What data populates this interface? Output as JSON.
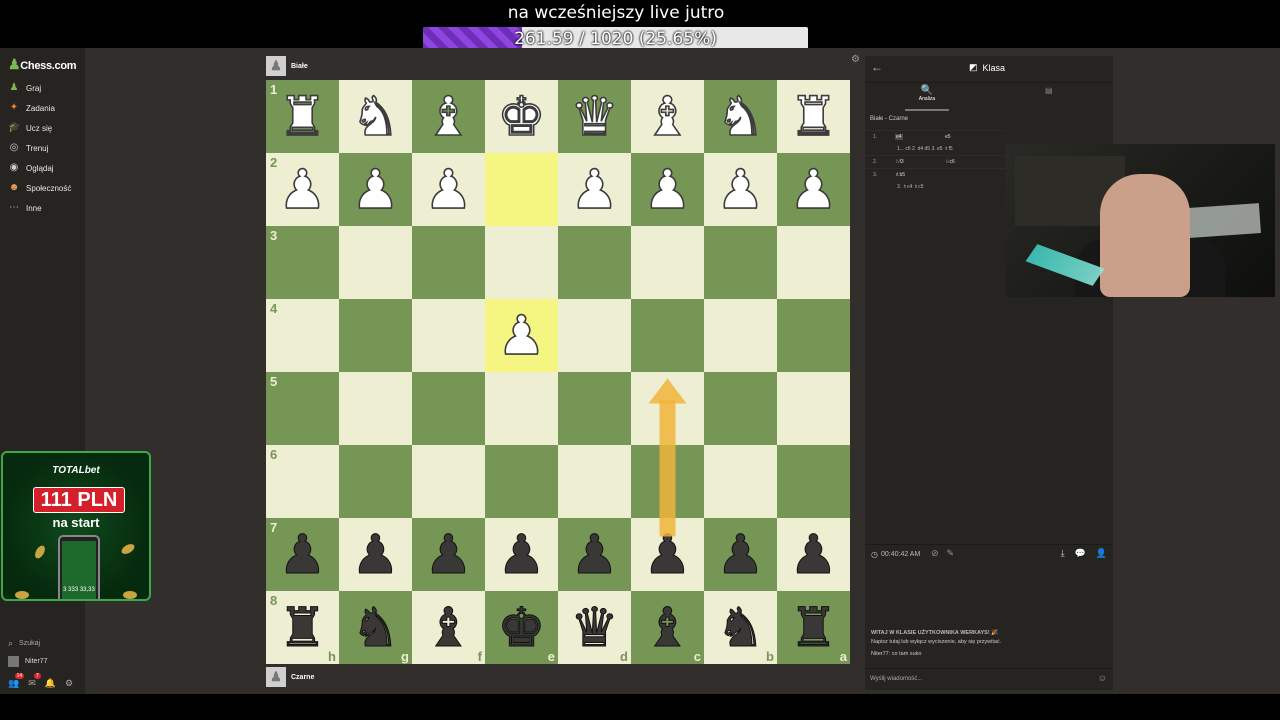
{
  "stream": {
    "title": "na wcześniejszy live jutro",
    "goal_text": "261.59 / 1020 (25.65%)",
    "goal_fraction": 0.2565
  },
  "sidebar": {
    "logo": "Chess.com",
    "items": [
      {
        "label": "Graj",
        "icon": "pawn-play-icon",
        "color": "#81b64c"
      },
      {
        "label": "Zadania",
        "icon": "puzzle-icon",
        "color": "#f07a2d"
      },
      {
        "label": "Ucz się",
        "icon": "graduation-cap-icon",
        "color": "#3aa6e0"
      },
      {
        "label": "Trenuj",
        "icon": "target-icon",
        "color": "#cccccc"
      },
      {
        "label": "Oglądaj",
        "icon": "binoculars-icon",
        "color": "#cccccc"
      },
      {
        "label": "Społeczność",
        "icon": "community-icon",
        "color": "#e8a15b"
      },
      {
        "label": "Inne",
        "icon": "ellipsis-icon",
        "color": "#cccccc"
      }
    ],
    "search_label": "Szukaj",
    "username": "Niter77",
    "badge_counts": [
      "14",
      "7"
    ]
  },
  "ad": {
    "brand": "TOTALbet",
    "amount": "111 PLN",
    "subtitle": "na start",
    "phone_amount": "3 333 33,33"
  },
  "game": {
    "top_player": "Białe",
    "bottom_player": "Czarne",
    "ranks": [
      "1",
      "2",
      "3",
      "4",
      "5",
      "6",
      "7",
      "8"
    ],
    "files": [
      "h",
      "g",
      "f",
      "e",
      "d",
      "c",
      "b",
      "a"
    ],
    "colors": {
      "light": "#eeeed2",
      "dark": "#769656",
      "highlight": "#f5f682",
      "arrow": "#f0b43a"
    },
    "highlight_squares": [
      "e2",
      "e4"
    ],
    "arrow": {
      "from": "c7",
      "to": "c5"
    },
    "pieces": [
      {
        "sq": "a1",
        "p": "R",
        "c": "w"
      },
      {
        "sq": "b1",
        "p": "N",
        "c": "w"
      },
      {
        "sq": "c1",
        "p": "B",
        "c": "w"
      },
      {
        "sq": "d1",
        "p": "Q",
        "c": "w"
      },
      {
        "sq": "e1",
        "p": "K",
        "c": "w"
      },
      {
        "sq": "f1",
        "p": "B",
        "c": "w"
      },
      {
        "sq": "g1",
        "p": "N",
        "c": "w"
      },
      {
        "sq": "h1",
        "p": "R",
        "c": "w"
      },
      {
        "sq": "a2",
        "p": "P",
        "c": "w"
      },
      {
        "sq": "b2",
        "p": "P",
        "c": "w"
      },
      {
        "sq": "c2",
        "p": "P",
        "c": "w"
      },
      {
        "sq": "d2",
        "p": "P",
        "c": "w"
      },
      {
        "sq": "f2",
        "p": "P",
        "c": "w"
      },
      {
        "sq": "g2",
        "p": "P",
        "c": "w"
      },
      {
        "sq": "h2",
        "p": "P",
        "c": "w"
      },
      {
        "sq": "e4",
        "p": "P",
        "c": "w"
      },
      {
        "sq": "a7",
        "p": "P",
        "c": "b"
      },
      {
        "sq": "b7",
        "p": "P",
        "c": "b"
      },
      {
        "sq": "c7",
        "p": "P",
        "c": "b"
      },
      {
        "sq": "d7",
        "p": "P",
        "c": "b"
      },
      {
        "sq": "e7",
        "p": "P",
        "c": "b"
      },
      {
        "sq": "f7",
        "p": "P",
        "c": "b"
      },
      {
        "sq": "g7",
        "p": "P",
        "c": "b"
      },
      {
        "sq": "h7",
        "p": "P",
        "c": "b"
      },
      {
        "sq": "a8",
        "p": "R",
        "c": "b"
      },
      {
        "sq": "b8",
        "p": "N",
        "c": "b"
      },
      {
        "sq": "c8",
        "p": "B",
        "c": "b"
      },
      {
        "sq": "d8",
        "p": "Q",
        "c": "b"
      },
      {
        "sq": "e8",
        "p": "K",
        "c": "b"
      },
      {
        "sq": "f8",
        "p": "B",
        "c": "b"
      },
      {
        "sq": "g8",
        "p": "N",
        "c": "b"
      },
      {
        "sq": "h8",
        "p": "R",
        "c": "b"
      }
    ]
  },
  "panel": {
    "title": "Klasa",
    "tab_analysis": "Analiza",
    "game_label": "Białe - Czarne",
    "moves": [
      {
        "num": "1.",
        "white": "e4",
        "black": "e5",
        "active": true
      },
      {
        "variation": "1... c6  2. d4  d5  3. e5  ♗f5"
      },
      {
        "num": "2.",
        "white": "♘f3",
        "black": "♘c6"
      },
      {
        "num": "3.",
        "white": "♗b5",
        "black": ""
      },
      {
        "variation": "3. ♗c4  ♗c5"
      }
    ],
    "clock": "00:40:42 AM",
    "chat_welcome": "WITAJ W KLASIE UŻYTKOWNIKA WERKAYS! 🎉",
    "chat_hint": "Napisz tutaj lub wyłącz wyciszenie, aby się przywitać.",
    "chat_message": "Niter77: co tam suko",
    "chat_placeholder": "Wyślij wiadomość..."
  }
}
